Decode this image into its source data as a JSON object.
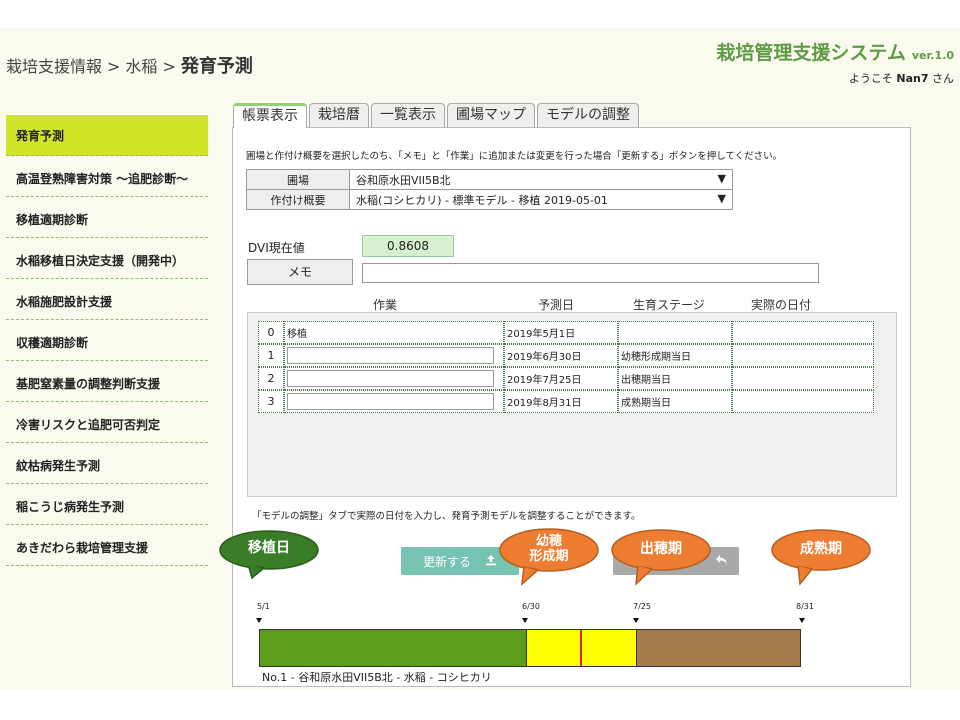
{
  "breadcrumb": {
    "part1": "栽培支援情報",
    "sep": ">",
    "part2": "水稲",
    "current": "発育予測"
  },
  "system": {
    "title": "栽培管理支援システム",
    "version": "ver.1.0",
    "welcome_prefix": "ようこそ",
    "user": "Nan7",
    "welcome_suffix": "さん"
  },
  "sidebar": {
    "items": [
      {
        "label": "発育予測",
        "active": true
      },
      {
        "label": "高温登熟障害対策 ～追肥診断～"
      },
      {
        "label": "移植適期診断"
      },
      {
        "label": "水稲移植日決定支援（開発中）"
      },
      {
        "label": "水稲施肥設計支援"
      },
      {
        "label": "収穫適期診断"
      },
      {
        "label": "基肥窒素量の調整判断支援"
      },
      {
        "label": "冷害リスクと追肥可否判定"
      },
      {
        "label": "紋枯病発生予測"
      },
      {
        "label": "稲こうじ病発生予測"
      },
      {
        "label": "あきだわら栽培管理支援"
      }
    ]
  },
  "tabs": [
    {
      "label": "帳票表示",
      "active": true
    },
    {
      "label": "栽培暦"
    },
    {
      "label": "一覧表示"
    },
    {
      "label": "圃場マップ"
    },
    {
      "label": "モデルの調整"
    }
  ],
  "form": {
    "instruction": "圃場と作付け概要を選択したのち、「メモ」と「作業」に追加または変更を行った場合「更新する」ボタンを押してください。",
    "field_label": "圃場",
    "field_value": "谷和原水田VII5B北",
    "plan_label": "作付け概要",
    "plan_value": "水稲(コシヒカリ) - 標準モデル - 移植 2019-05-01",
    "dvi_label": "DVI現在値",
    "dvi_value": "0.8608",
    "memo_label": "メモ",
    "memo_value": ""
  },
  "table": {
    "headers": [
      "作業",
      "予測日",
      "生育ステージ",
      "実際の日付"
    ],
    "rows": [
      {
        "no": "0",
        "work": "移植",
        "date": "2019年5月1日",
        "stage": "",
        "actual": ""
      },
      {
        "no": "1",
        "work": "",
        "date": "2019年6月30日",
        "stage": "幼穂形成期当日",
        "actual": ""
      },
      {
        "no": "2",
        "work": "",
        "date": "2019年7月25日",
        "stage": "出穂期当日",
        "actual": ""
      },
      {
        "no": "3",
        "work": "",
        "date": "2019年8月31日",
        "stage": "成熟期当日",
        "actual": ""
      }
    ]
  },
  "note": "「モデルの調整」タブで実際の日付を入力し、発育予測モデルを調整することができます。",
  "buttons": {
    "update": "更新する",
    "update_icon": "upload-icon",
    "back_icon": "undo-icon"
  },
  "timeline": {
    "dates": [
      "5/1",
      "6/30",
      "7/25",
      "8/31"
    ],
    "segments": [
      {
        "from": "5/1",
        "to": "6/30",
        "color": "#5c9e1c"
      },
      {
        "from": "6/30",
        "to": "7/25",
        "color": "#ffff00"
      },
      {
        "from": "7/25",
        "to": "8/31",
        "color": "#a67c4c"
      }
    ],
    "marker_color": "#e02020",
    "caption": "No.1 - 谷和原水田VII5B北 - 水稲 - コシヒカリ"
  },
  "callouts": [
    {
      "text": "移植日",
      "color": "#3a7d28"
    },
    {
      "text": "幼穂\n形成期",
      "color": "#ed7d31"
    },
    {
      "text": "出穂期",
      "color": "#ed7d31"
    },
    {
      "text": "成熟期",
      "color": "#ed7d31"
    }
  ]
}
